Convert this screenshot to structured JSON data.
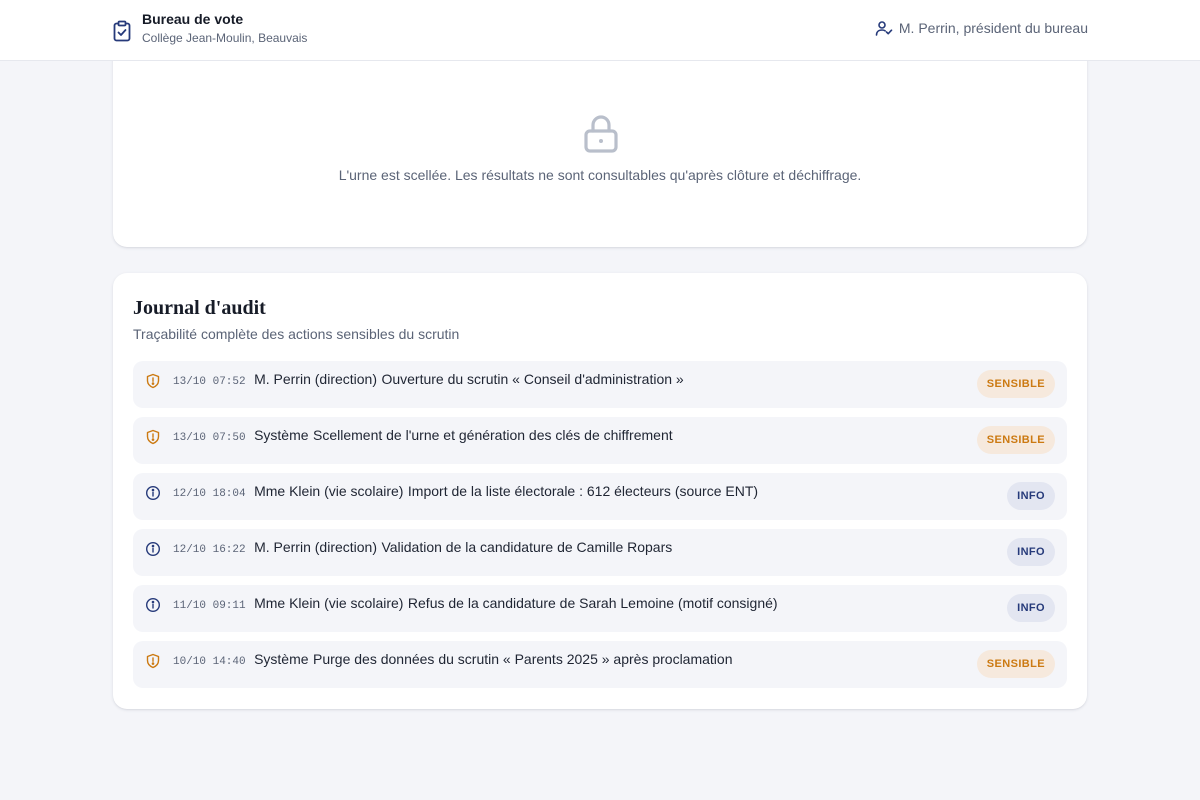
{
  "header": {
    "title": "Bureau de vote",
    "subtitle": "Collège Jean-Moulin, Beauvais",
    "user": "M. Perrin, président du bureau",
    "brand_icon": "clipboard-check-icon",
    "user_icon": "user-check-icon"
  },
  "sealed": {
    "icon": "lock-icon",
    "message": "L'urne est scellée. Les résultats ne sont consultables qu'après clôture et déchiffrage."
  },
  "audit": {
    "title": "Journal d'audit",
    "subtitle": "Traçabilité complète des actions sensibles du scrutin",
    "entries": [
      {
        "level": "sensible",
        "icon": "shield-alert-icon",
        "timestamp": "13/10 07:52",
        "actor": "M. Perrin (direction)",
        "action": "Ouverture du scrutin « Conseil d'administration »",
        "badge": "SENSIBLE"
      },
      {
        "level": "sensible",
        "icon": "shield-alert-icon",
        "timestamp": "13/10 07:50",
        "actor": "Système",
        "action": "Scellement de l'urne et génération des clés de chiffrement",
        "badge": "SENSIBLE"
      },
      {
        "level": "info",
        "icon": "info-circle-icon",
        "timestamp": "12/10 18:04",
        "actor": "Mme Klein (vie scolaire)",
        "action": "Import de la liste électorale : 612 électeurs (source ENT)",
        "badge": "INFO"
      },
      {
        "level": "info",
        "icon": "info-circle-icon",
        "timestamp": "12/10 16:22",
        "actor": "M. Perrin (direction)",
        "action": "Validation de la candidature de Camille Ropars",
        "badge": "INFO"
      },
      {
        "level": "info",
        "icon": "info-circle-icon",
        "timestamp": "11/10 09:11",
        "actor": "Mme Klein (vie scolaire)",
        "action": "Refus de la candidature de Sarah Lemoine (motif consigné)",
        "badge": "INFO"
      },
      {
        "level": "sensible",
        "icon": "shield-alert-icon",
        "timestamp": "10/10 14:40",
        "actor": "Système",
        "action": "Purge des données du scrutin « Parents 2025 » après proclamation",
        "badge": "SENSIBLE"
      }
    ]
  },
  "colors": {
    "accent": "#263a7a",
    "sensible": "#cc7a12",
    "sensible_bg": "#f6e9dd",
    "info_bg": "#e3e6f1",
    "page_bg": "#f4f5f9"
  }
}
